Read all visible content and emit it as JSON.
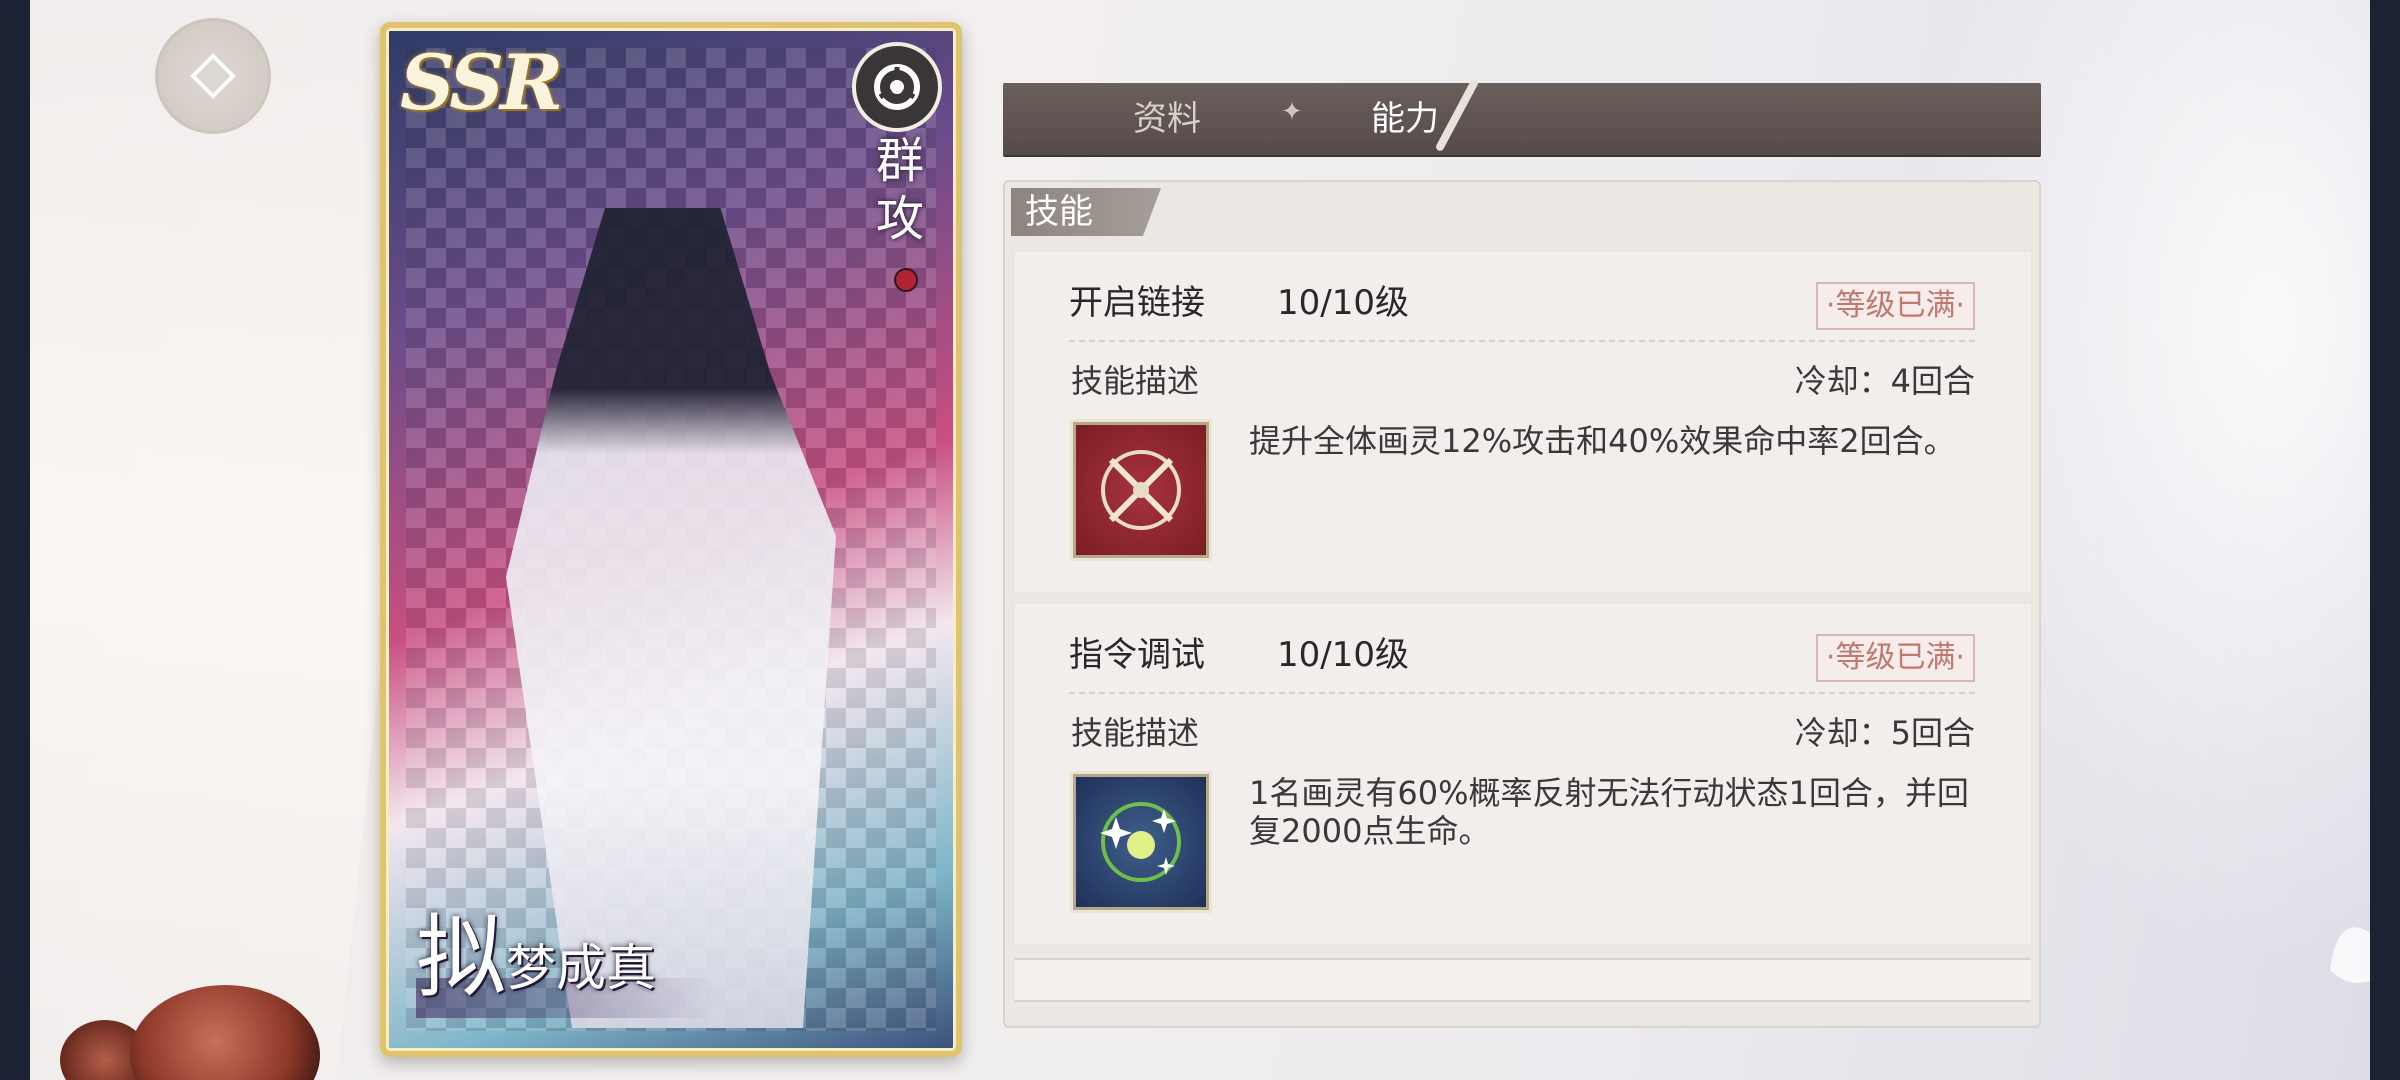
{
  "card": {
    "rarity": "SSR",
    "class_label": "群攻",
    "title_big": "拟",
    "title_small": "梦成真",
    "class_icon": "group-attack-icon"
  },
  "tabs": [
    {
      "label": "资料",
      "active": false
    },
    {
      "label": "能力",
      "active": true
    }
  ],
  "tab_separator": "✦",
  "panel": {
    "tag": "技能",
    "skills": [
      {
        "name": "开启链接",
        "level": "10/10级",
        "badge": "·等级已满·",
        "desc_label": "技能描述",
        "cooldown": "冷却：4回合",
        "description": "提升全体画灵12%攻击和40%效果命中率2回合。",
        "icon": "crossed-swords-icon"
      },
      {
        "name": "指令调试",
        "level": "10/10级",
        "badge": "·等级已满·",
        "desc_label": "技能描述",
        "cooldown": "冷却：5回合",
        "description": "1名画灵有60%概率反射无法行动状态1回合，并回复2000点生命。",
        "icon": "sparkle-orb-icon"
      }
    ]
  },
  "colors": {
    "tab_bar": "#5f5453",
    "badge_text": "#c07970",
    "card_frame": "#e0c36e",
    "icon_red": "#a8333c",
    "icon_blue": "#2e4a78"
  }
}
